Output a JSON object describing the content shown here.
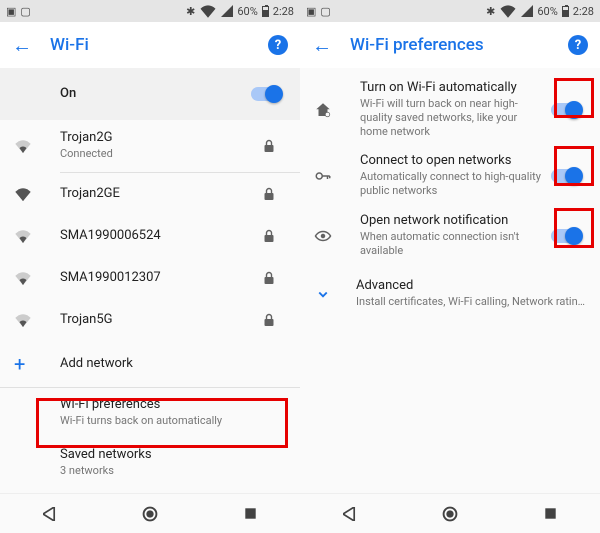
{
  "status": {
    "battery_pct": "60%",
    "time": "2:28"
  },
  "left": {
    "title": "Wi-Fi",
    "master_label": "On",
    "networks": [
      {
        "ssid": "Trojan2G",
        "sub": "Connected",
        "strength": 2,
        "locked": true
      },
      {
        "ssid": "Trojan2GE",
        "sub": "",
        "strength": 4,
        "locked": true
      },
      {
        "ssid": "SMA1990006524",
        "sub": "",
        "strength": 2,
        "locked": true
      },
      {
        "ssid": "SMA1990012307",
        "sub": "",
        "strength": 2,
        "locked": true
      },
      {
        "ssid": "Trojan5G",
        "sub": "",
        "strength": 2,
        "locked": true
      }
    ],
    "add_label": "Add network",
    "pref_label": "Wi-Fi preferences",
    "pref_sub": "Wi-Fi turns back on automatically",
    "saved_label": "Saved networks",
    "saved_sub": "3 networks"
  },
  "right": {
    "title": "Wi-Fi preferences",
    "items": [
      {
        "primary": "Turn on Wi-Fi automatically",
        "secondary": "Wi-Fi will turn back on near high-quality saved networks, like your home network",
        "toggle_on": true
      },
      {
        "primary": "Connect to open networks",
        "secondary": "Automatically connect to high-quality public networks",
        "toggle_on": true
      },
      {
        "primary": "Open network notification",
        "secondary": "When automatic connection isn't available",
        "toggle_on": true
      },
      {
        "primary": "Advanced",
        "secondary": "Install certificates, Wi-Fi calling, Network rating pro..."
      }
    ]
  }
}
